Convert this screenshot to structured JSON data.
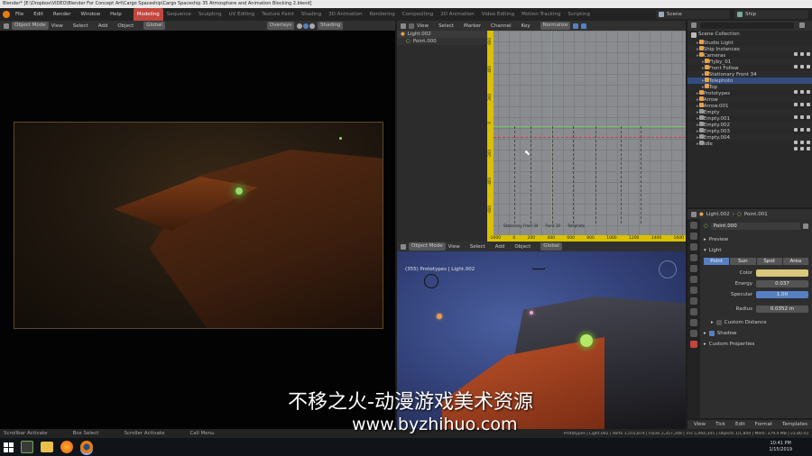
{
  "window": {
    "title": "Blender* [E:\\Dropbox\\VIDEO\\Blender For Concept Art\\Cargo Spaceship\\Cargo Spaceship 35 Atmosphere and Animation Blocking 2.blend]"
  },
  "menu": [
    "File",
    "Edit",
    "Render",
    "Window",
    "Help"
  ],
  "workspaces": [
    "Modeling",
    "Sequence",
    "Sculpting",
    "UV Editing",
    "Texture Paint",
    "Shading",
    "3D Animation",
    "Rendering",
    "Compositing",
    "2D Animation",
    "Video Editing",
    "Motion Tracking",
    "Scripting"
  ],
  "scene": {
    "label": "Scene",
    "layer": "Ship"
  },
  "left_view": {
    "mode": "Object Mode",
    "menu": [
      "View",
      "Select",
      "Add",
      "Object"
    ],
    "orient": "Global",
    "overlays": "Overlays",
    "shading": "Shading"
  },
  "graph": {
    "menu": [
      "View",
      "Select",
      "Marker",
      "Channel",
      "Key"
    ],
    "normalize": "Normalize",
    "channels": [
      "Light.002",
      "Point.000"
    ],
    "y_ticks": [
      "600",
      "400",
      "200",
      "0",
      "-200",
      "-400",
      "-600"
    ],
    "x_ticks": [
      "-1000",
      "0",
      "200",
      "400",
      "600",
      "800",
      "1000",
      "1200",
      "1400",
      "1600"
    ],
    "frame": "0 1",
    "markers": [
      "Stationary Front 34",
      "Front 10",
      "Telephoto"
    ]
  },
  "bottom_view": {
    "mode": "Object Mode",
    "menu": [
      "View",
      "Select",
      "Add",
      "Object"
    ],
    "orient": "Global",
    "info": "(355) Prototypes | Light.002"
  },
  "outliner": {
    "title": "Scene Collection",
    "items": [
      {
        "label": "Studio Light",
        "indent": 1,
        "color": "#e8a04a"
      },
      {
        "label": "Ship Instances",
        "indent": 1,
        "color": "#e8a04a"
      },
      {
        "label": "Cameras",
        "indent": 1,
        "color": "#e8a04a"
      },
      {
        "label": "Flyby_01",
        "indent": 2,
        "color": "#e8a04a"
      },
      {
        "label": "Front Follow",
        "indent": 2,
        "color": "#e8a04a"
      },
      {
        "label": "Stationary Front 34",
        "indent": 2,
        "color": "#e8a04a"
      },
      {
        "label": "Telephoto",
        "indent": 2,
        "color": "#e8a04a",
        "selected": true
      },
      {
        "label": "Top",
        "indent": 2,
        "color": "#e8a04a"
      },
      {
        "label": "Prototypes",
        "indent": 1,
        "color": "#e8a04a"
      },
      {
        "label": "Arrow",
        "indent": 1,
        "color": "#e8a04a"
      },
      {
        "label": "Arrow.001",
        "indent": 1,
        "color": "#e8a04a"
      },
      {
        "label": "Empty",
        "indent": 1,
        "color": "#9a9a9a"
      },
      {
        "label": "Empty.001",
        "indent": 1,
        "color": "#9a9a9a"
      },
      {
        "label": "Empty.002",
        "indent": 1,
        "color": "#9a9a9a"
      },
      {
        "label": "Empty.003",
        "indent": 1,
        "color": "#9a9a9a"
      },
      {
        "label": "Empty.004",
        "indent": 1,
        "color": "#9a9a9a"
      },
      {
        "label": "Idle",
        "indent": 1,
        "color": "#9a9a9a"
      }
    ]
  },
  "properties": {
    "breadcrumb": [
      "Light.002",
      "Point.001"
    ],
    "datablock": "Point.000",
    "sections": {
      "preview": "Preview",
      "light": "Light",
      "custom_distance": "Custom Distance",
      "shadow": "Shadow",
      "custom_props": "Custom Properties"
    },
    "types": [
      "Point",
      "Sun",
      "Spot",
      "Area"
    ],
    "fields": {
      "color": {
        "label": "Color",
        "value": "#d9c77a"
      },
      "energy": {
        "label": "Energy",
        "value": "0.037"
      },
      "specular": {
        "label": "Specular",
        "value": "1.00"
      },
      "radius": {
        "label": "Radius",
        "value": "0.0352 m"
      }
    }
  },
  "timeline_menu": [
    "View",
    "Tick",
    "Edit",
    "Format",
    "Templates"
  ],
  "status_bar": {
    "left": [
      "Scrollbar Activate",
      "Box Select",
      "Scroller Activate",
      "Call Menu"
    ],
    "right": "Prototypes | Light.002 | Verts 1,555,874 | Faces 2,357,348 | Tris 5,064,345 | Objects 1/1,844 | Mem: 379.4 MB | v2.80.43"
  },
  "taskbar": {
    "time": "10:41 PM",
    "date": "1/15/2019"
  },
  "watermark": {
    "title": "不移之火-动漫游戏美术资源",
    "url": "www.byzhihuo.com"
  },
  "colors": {
    "accent": "#c3463f",
    "frame_line": "#5fa4f1",
    "yellow": "#d9c100",
    "select": "#5680c2"
  }
}
